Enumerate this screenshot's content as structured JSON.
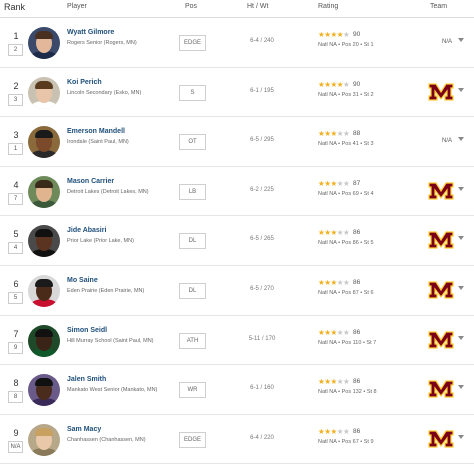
{
  "header": {
    "rank": "Rank",
    "player": "Player",
    "pos": "Pos",
    "htwt": "Ht / Wt",
    "rating": "Rating",
    "team": "Team"
  },
  "colors": {
    "star": "#f2b01e",
    "star_off": "#c8c8c8",
    "team_maroon": "#7a0019",
    "team_gold": "#ffcc33",
    "name": "#1f4f7a"
  },
  "players": [
    {
      "rank": "1",
      "sub": "2",
      "name": "Wyatt Gilmore",
      "school": "Rogers Senior (Rogers, MN)",
      "pos": "EDGE",
      "htwt": "6-4 / 240",
      "stars": 4,
      "score": "90",
      "natl": "Natl NA",
      "pos_rank": "Pos 20",
      "st_rank": "St 1",
      "team": "N/A",
      "team_logo": false,
      "photo": {
        "bg": "#3b4a6b",
        "skin": "#e2b79a",
        "shirt": "#1d2b4a",
        "hair": "#4a3020"
      }
    },
    {
      "rank": "2",
      "sub": "3",
      "name": "Koi Perich",
      "school": "Lincoln Secondary (Esko, MN)",
      "pos": "S",
      "htwt": "6-1 / 195",
      "stars": 4,
      "score": "90",
      "natl": "Natl NA",
      "pos_rank": "Pos 31",
      "st_rank": "St 2",
      "team": "",
      "team_logo": true,
      "photo": {
        "bg": "#c9c2b2",
        "skin": "#e8c4a8",
        "shirt": "#ffffff",
        "hair": "#5a3a1e"
      }
    },
    {
      "rank": "3",
      "sub": "1",
      "name": "Emerson Mandell",
      "school": "Irondale (Saint Paul, MN)",
      "pos": "OT",
      "htwt": "6-5 / 295",
      "stars": 3,
      "score": "88",
      "natl": "Natl NA",
      "pos_rank": "Pos 41",
      "st_rank": "St 3",
      "team": "N/A",
      "team_logo": false,
      "photo": {
        "bg": "#8a6a3a",
        "skin": "#7a4a2a",
        "shirt": "#2a2a2a",
        "hair": "#1a1a1a"
      }
    },
    {
      "rank": "4",
      "sub": "7",
      "name": "Mason Carrier",
      "school": "Detroit Lakes (Detroit Lakes, MN)",
      "pos": "LB",
      "htwt": "6-2 / 225",
      "stars": 3,
      "score": "87",
      "natl": "Natl NA",
      "pos_rank": "Pos 69",
      "st_rank": "St 4",
      "team": "",
      "team_logo": true,
      "photo": {
        "bg": "#6e8a5a",
        "skin": "#e0b48f",
        "shirt": "#3a5a3a",
        "hair": "#3a2a1a"
      }
    },
    {
      "rank": "5",
      "sub": "4",
      "name": "Jide Abasiri",
      "school": "Prior Lake (Prior Lake, MN)",
      "pos": "DL",
      "htwt": "6-5 / 265",
      "stars": 3,
      "score": "86",
      "natl": "Natl NA",
      "pos_rank": "Pos 86",
      "st_rank": "St 5",
      "team": "",
      "team_logo": true,
      "photo": {
        "bg": "#4a4a4a",
        "skin": "#5a3420",
        "shirt": "#111111",
        "hair": "#111111"
      }
    },
    {
      "rank": "6",
      "sub": "5",
      "name": "Mo Saine",
      "school": "Eden Prairie (Eden Prairie, MN)",
      "pos": "DL",
      "htwt": "6-5 / 270",
      "stars": 3,
      "score": "86",
      "natl": "Natl NA",
      "pos_rank": "Pos 87",
      "st_rank": "St 6",
      "team": "",
      "team_logo": true,
      "photo": {
        "bg": "#d8d8d8",
        "skin": "#4a2a18",
        "shirt": "#c8102e",
        "hair": "#1a1a1a"
      }
    },
    {
      "rank": "7",
      "sub": "9",
      "name": "Simon Seidl",
      "school": "Hill Murray School (Saint Paul, MN)",
      "pos": "ATH",
      "htwt": "5-11 / 170",
      "stars": 3,
      "score": "86",
      "natl": "Natl NA",
      "pos_rank": "Pos 110",
      "st_rank": "St 7",
      "team": "",
      "team_logo": true,
      "photo": {
        "bg": "#1e4a2a",
        "skin": "#3a2418",
        "shirt": "#0f5a2a",
        "hair": "#111111"
      }
    },
    {
      "rank": "8",
      "sub": "8",
      "name": "Jalen Smith",
      "school": "Mankato West Senior (Mankato, MN)",
      "pos": "WR",
      "htwt": "6-1 / 160",
      "stars": 3,
      "score": "86",
      "natl": "Natl NA",
      "pos_rank": "Pos 132",
      "st_rank": "St 8",
      "team": "",
      "team_logo": true,
      "photo": {
        "bg": "#6a5a8a",
        "skin": "#4a2c1c",
        "shirt": "#3a2a5a",
        "hair": "#111111"
      }
    },
    {
      "rank": "9",
      "sub": "N/A",
      "name": "Sam Macy",
      "school": "Chanhassen (Chanhassen, MN)",
      "pos": "EDGE",
      "htwt": "6-4 / 220",
      "stars": 3,
      "score": "86",
      "natl": "Natl NA",
      "pos_rank": "Pos 67",
      "st_rank": "St 9",
      "team": "",
      "team_logo": true,
      "photo": {
        "bg": "#b8a88a",
        "skin": "#e8c8a8",
        "shirt": "#8a7a5a",
        "hair": "#c8a060"
      }
    }
  ]
}
